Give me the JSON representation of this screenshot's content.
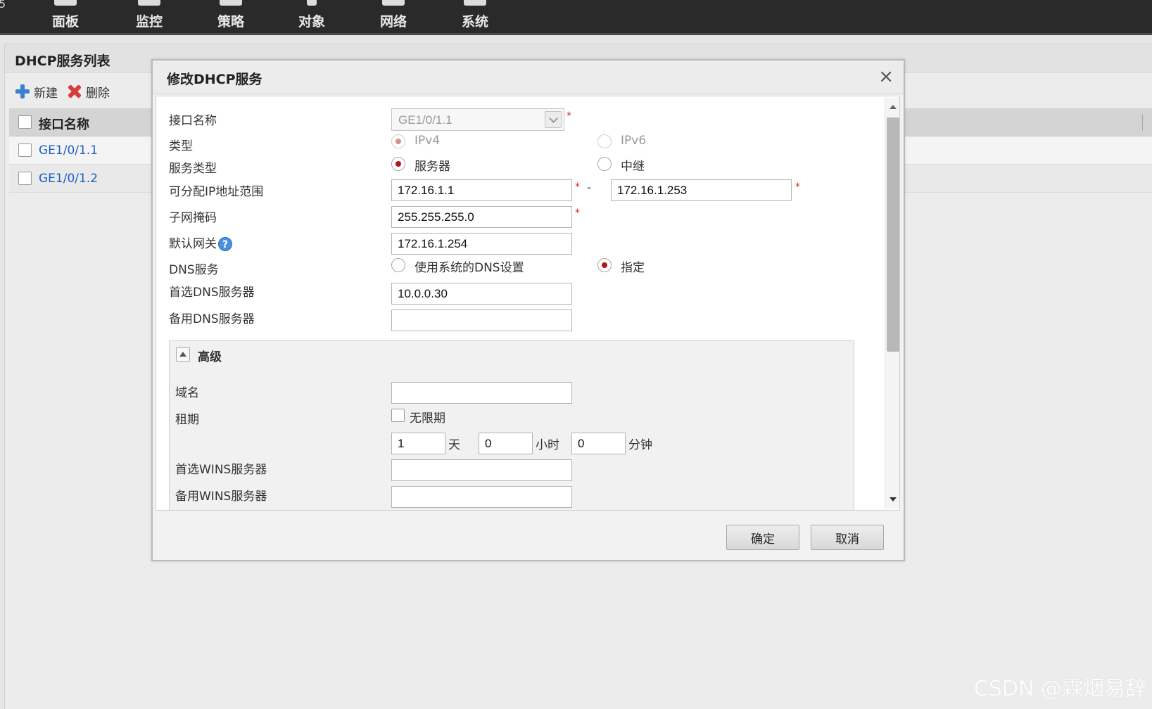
{
  "topbar": {
    "edge_glyph": "5",
    "items": [
      {
        "label": "面板",
        "icon": "dashboard-icon"
      },
      {
        "label": "监控",
        "icon": "monitor-icon"
      },
      {
        "label": "策略",
        "icon": "policy-icon"
      },
      {
        "label": "对象",
        "icon": "object-icon"
      },
      {
        "label": "网络",
        "icon": "network-icon"
      },
      {
        "label": "系统",
        "icon": "system-icon"
      }
    ]
  },
  "page": {
    "title": "DHCP服务列表",
    "toolbar": {
      "new_label": "新建",
      "delete_label": "删除"
    },
    "table": {
      "column_header": "接口名称",
      "rows": [
        "GE1/0/1.1",
        "GE1/0/1.2"
      ]
    }
  },
  "dialog": {
    "title": "修改DHCP服务",
    "close_label": "×",
    "fields": {
      "interface_label": "接口名称",
      "interface_value": "GE1/0/1.1",
      "type_label": "类型",
      "type_ipv4": "IPv4",
      "type_ipv6": "IPv6",
      "service_type_label": "服务类型",
      "service_server": "服务器",
      "service_relay": "中继",
      "ip_range_label": "可分配IP地址范围",
      "ip_range_start": "172.16.1.1",
      "ip_range_dash": "-",
      "ip_range_end": "172.16.1.253",
      "subnet_label": "子网掩码",
      "subnet_value": "255.255.255.0",
      "gateway_label": "默认网关",
      "gateway_help": "?",
      "gateway_value": "172.16.1.254",
      "dns_label": "DNS服务",
      "dns_system": "使用系统的DNS设置",
      "dns_specify": "指定",
      "dns_primary_label": "首选DNS服务器",
      "dns_primary_value": "10.0.0.30",
      "dns_secondary_label": "备用DNS服务器",
      "dns_secondary_value": "",
      "required_mark": "*"
    },
    "advanced": {
      "title": "高级",
      "domain_label": "域名",
      "domain_value": "",
      "lease_label": "租期",
      "unlimited_label": "无限期",
      "days_value": "1",
      "days_unit": "天",
      "hours_value": "0",
      "hours_unit": "小时",
      "minutes_value": "0",
      "minutes_unit": "分钟",
      "wins_primary_label": "首选WINS服务器",
      "wins_primary_value": "",
      "wins_secondary_label": "备用WINS服务器",
      "wins_secondary_value": ""
    },
    "buttons": {
      "ok": "确定",
      "cancel": "取消"
    }
  },
  "watermark": "CSDN @霖烟易辞",
  "colors": {
    "accent_link": "#1c5fc5",
    "required": "#e02020",
    "radio_checked": "#b01818"
  }
}
